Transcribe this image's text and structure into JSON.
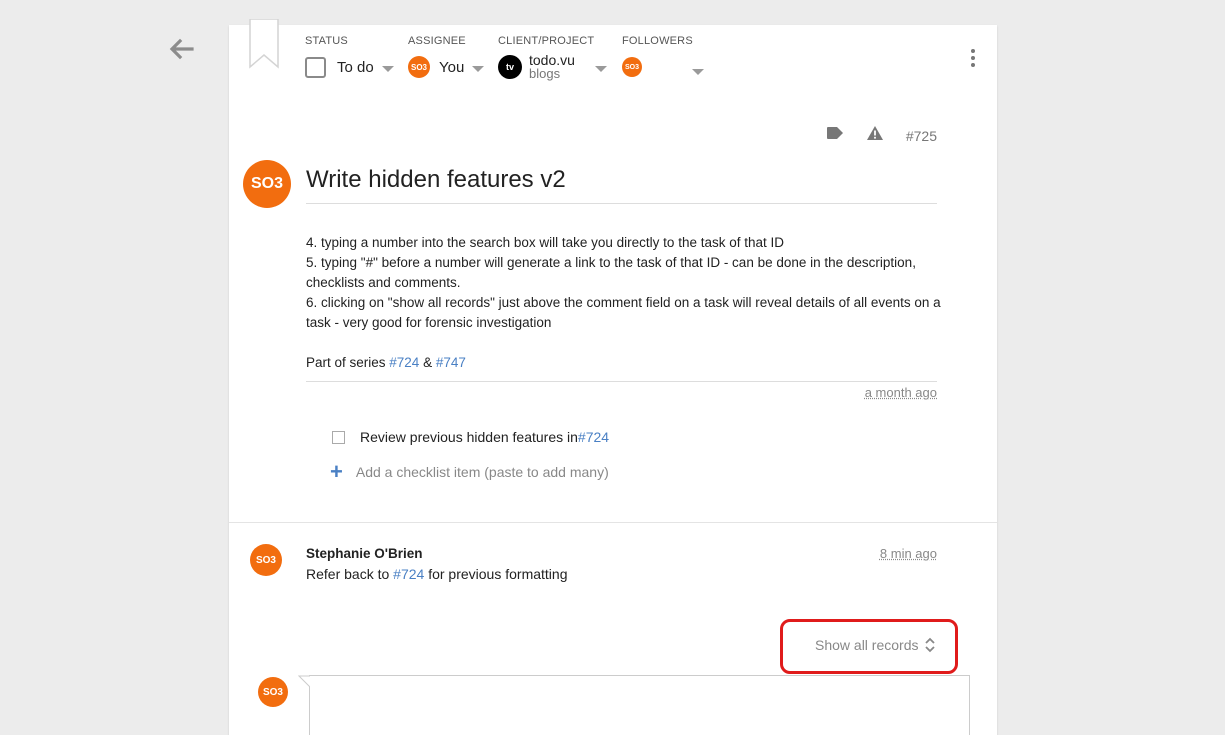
{
  "header": {
    "status": {
      "label": "STATUS",
      "value": "To do"
    },
    "assignee": {
      "label": "ASSIGNEE",
      "avatar": "SO3",
      "value": "You"
    },
    "project": {
      "label": "CLIENT/PROJECT",
      "logo": "tv",
      "name": "todo.vu",
      "sub": "blogs"
    },
    "followers": {
      "label": "FOLLOWERS",
      "avatar": "SO3"
    }
  },
  "meta": {
    "task_id": "#725"
  },
  "task": {
    "avatar": "SO3",
    "title": "Write hidden features v2",
    "description": [
      "4. typing a number into the search box will take you directly to the task of that ID",
      "5. typing \"#\" before a number will generate a link to the task of that ID - can be done in the description, checklists and comments.",
      "6. clicking on \"show all records\" just above the comment field on a task will reveal details of all events on a task - very good for forensic investigation"
    ],
    "series": {
      "prefix": "Part of series ",
      "link1": "#724",
      "sep": " & ",
      "link2": "#747"
    },
    "time": "a month ago"
  },
  "checklist": {
    "items": [
      {
        "text": "Review previous hidden features in ",
        "link": "#724"
      }
    ],
    "add_label": "Add a checklist item (paste to add many)"
  },
  "comment": {
    "avatar": "SO3",
    "author": "Stephanie O'Brien",
    "time": "8 min ago",
    "prefix": "Refer back to ",
    "link": "#724",
    "suffix": " for previous formatting"
  },
  "records": {
    "label": "Show all records"
  },
  "new_comment": {
    "avatar": "SO3"
  },
  "colors": {
    "accent": "#f26d0f",
    "link": "#4a80c4",
    "highlight": "#e01b1b"
  }
}
